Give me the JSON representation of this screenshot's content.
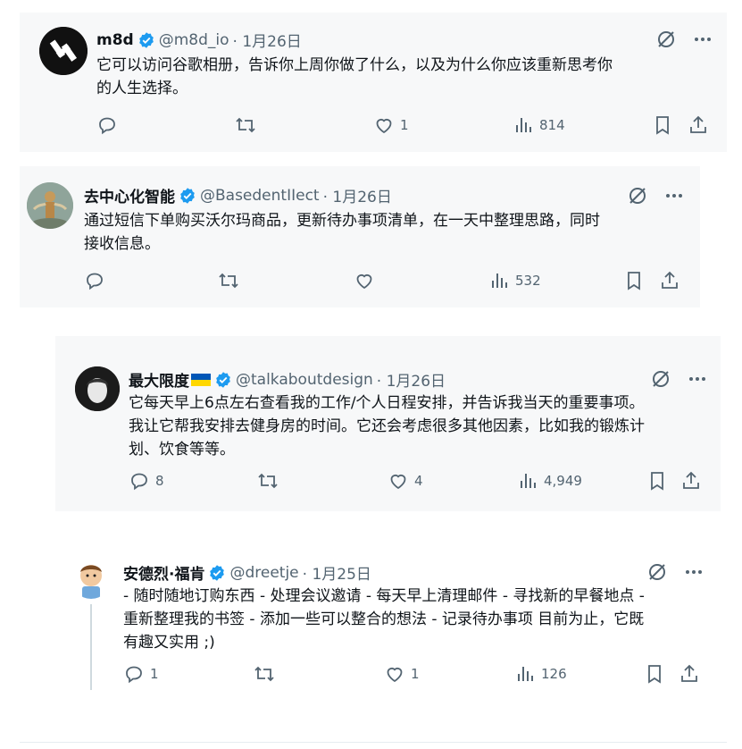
{
  "tweets": [
    {
      "name": "m8d",
      "handle": "@m8d_io",
      "date": "· 1月26日",
      "text_lines": [
        "它可以访问谷歌相册，告诉你上周你做了什么，以及为什么你应该重新思考你",
        "的人生选择。"
      ],
      "replies": "",
      "retweets": "",
      "likes": "1",
      "views": "814"
    },
    {
      "name": "去中心化智能",
      "handle": "@BasedentIIect",
      "date": "· 1月26日",
      "text_lines": [
        "通过短信下单购买沃尔玛商品，更新待办事项清单，在一天中整理思路，同时",
        "接收信息。"
      ],
      "replies": "",
      "retweets": "",
      "likes": "",
      "views": "532"
    },
    {
      "name": "最大限度",
      "handle": "@talkaboutdesign",
      "date": "· 1月26日",
      "text_lines": [
        "它每天早上6点左右查看我的工作/个人日程安排，并告诉我当天的重要事项。",
        "我让它帮我安排去健身房的时间。它还会考虑很多其他因素，比如我的锻炼计",
        "划、饮食等等。"
      ],
      "replies": "8",
      "retweets": "",
      "likes": "4",
      "views": "4,949"
    },
    {
      "name": "安德烈·福肯",
      "handle": "@dreetje",
      "date": "· 1月25日",
      "text_lines": [
        "- 随时随地订购东西 - 处理会议邀请 - 每天早上清理邮件 - 寻找新的早餐地点 -",
        "重新整理我的书签 - 添加一些可以整合的想法 - 记录待办事项 目前为止，它既",
        "有趣又实用 ;)"
      ],
      "replies": "1",
      "retweets": "",
      "likes": "1",
      "views": "126"
    }
  ],
  "colors": {
    "verified": "#1d9bf0",
    "icon": "#536471",
    "card": "#f7f8f9",
    "flag_blue": "#0057b7",
    "flag_yellow": "#ffd700"
  },
  "icons": [
    "verified-badge",
    "grok-icon",
    "more-icon",
    "reply-icon",
    "retweet-icon",
    "like-icon",
    "views-icon",
    "bookmark-icon",
    "share-icon"
  ]
}
